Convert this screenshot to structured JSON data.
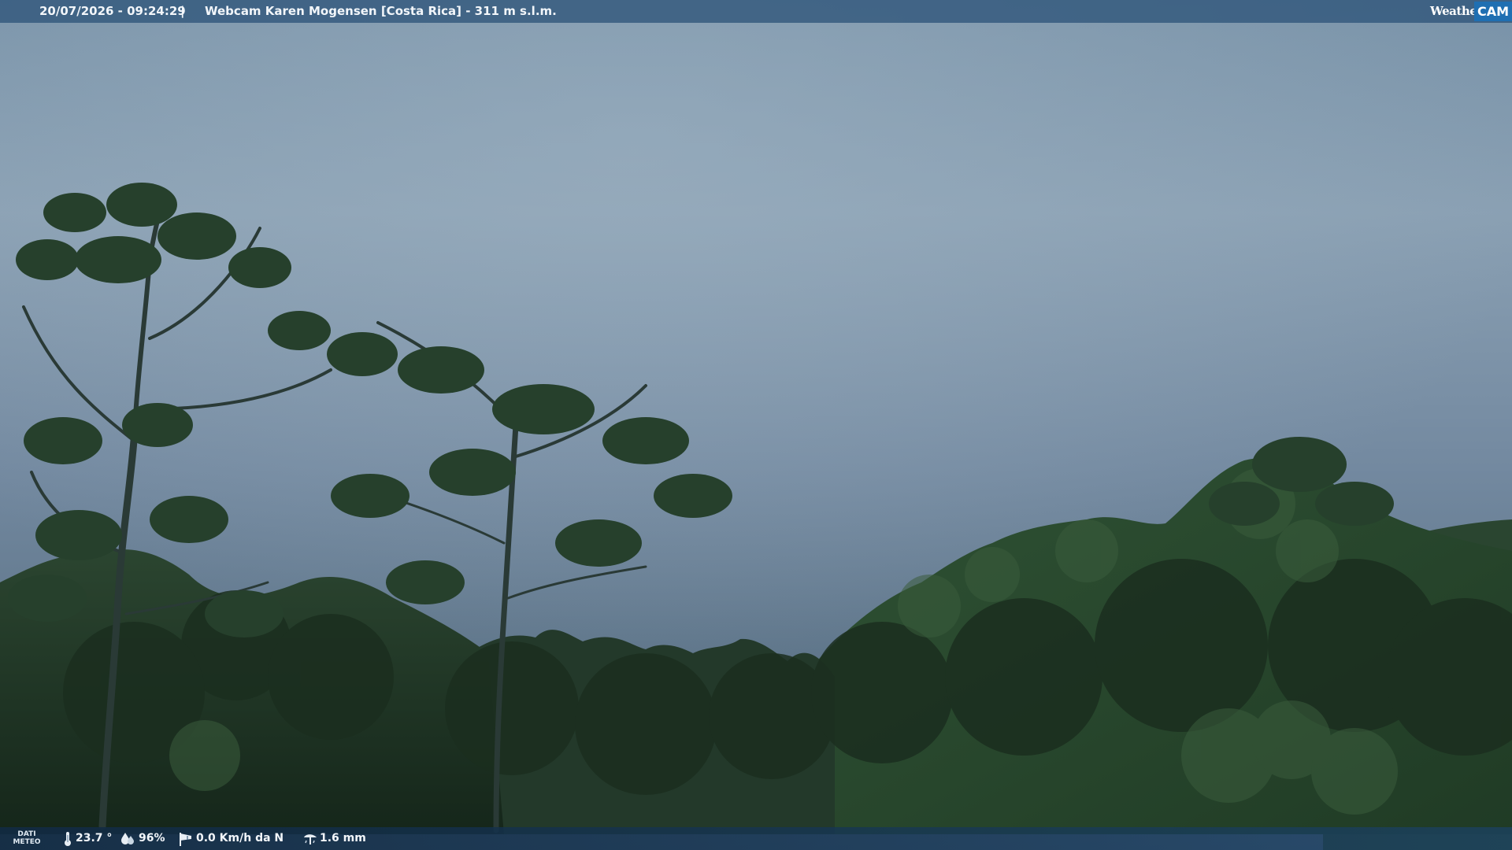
{
  "header": {
    "timestamp": "20/07/2026 - 09:24:29",
    "separator": "|",
    "camera_title": "Webcam Karen Mogensen [Costa Rica]  - 311 m s.l.m."
  },
  "brand": {
    "weather": "Weather",
    "cam": "CAM",
    "accent_color": "#1f6fb2"
  },
  "meteo": {
    "label_line1": "DATI",
    "label_line2": "METEO",
    "temperature": "23.7 °",
    "humidity": "96%",
    "wind": "0.0 Km/h da N",
    "rain": "1.6 mm",
    "icons": [
      "thermometer-icon",
      "humidity-drops-icon",
      "wind-sock-icon",
      "rain-gauge-icon"
    ]
  },
  "scene": {
    "sky_color": "#7d93a6",
    "forest_color": "#1e3320",
    "subjects": [
      "cloudy-sky",
      "tall-trees",
      "forest-canopy",
      "hillside"
    ]
  }
}
